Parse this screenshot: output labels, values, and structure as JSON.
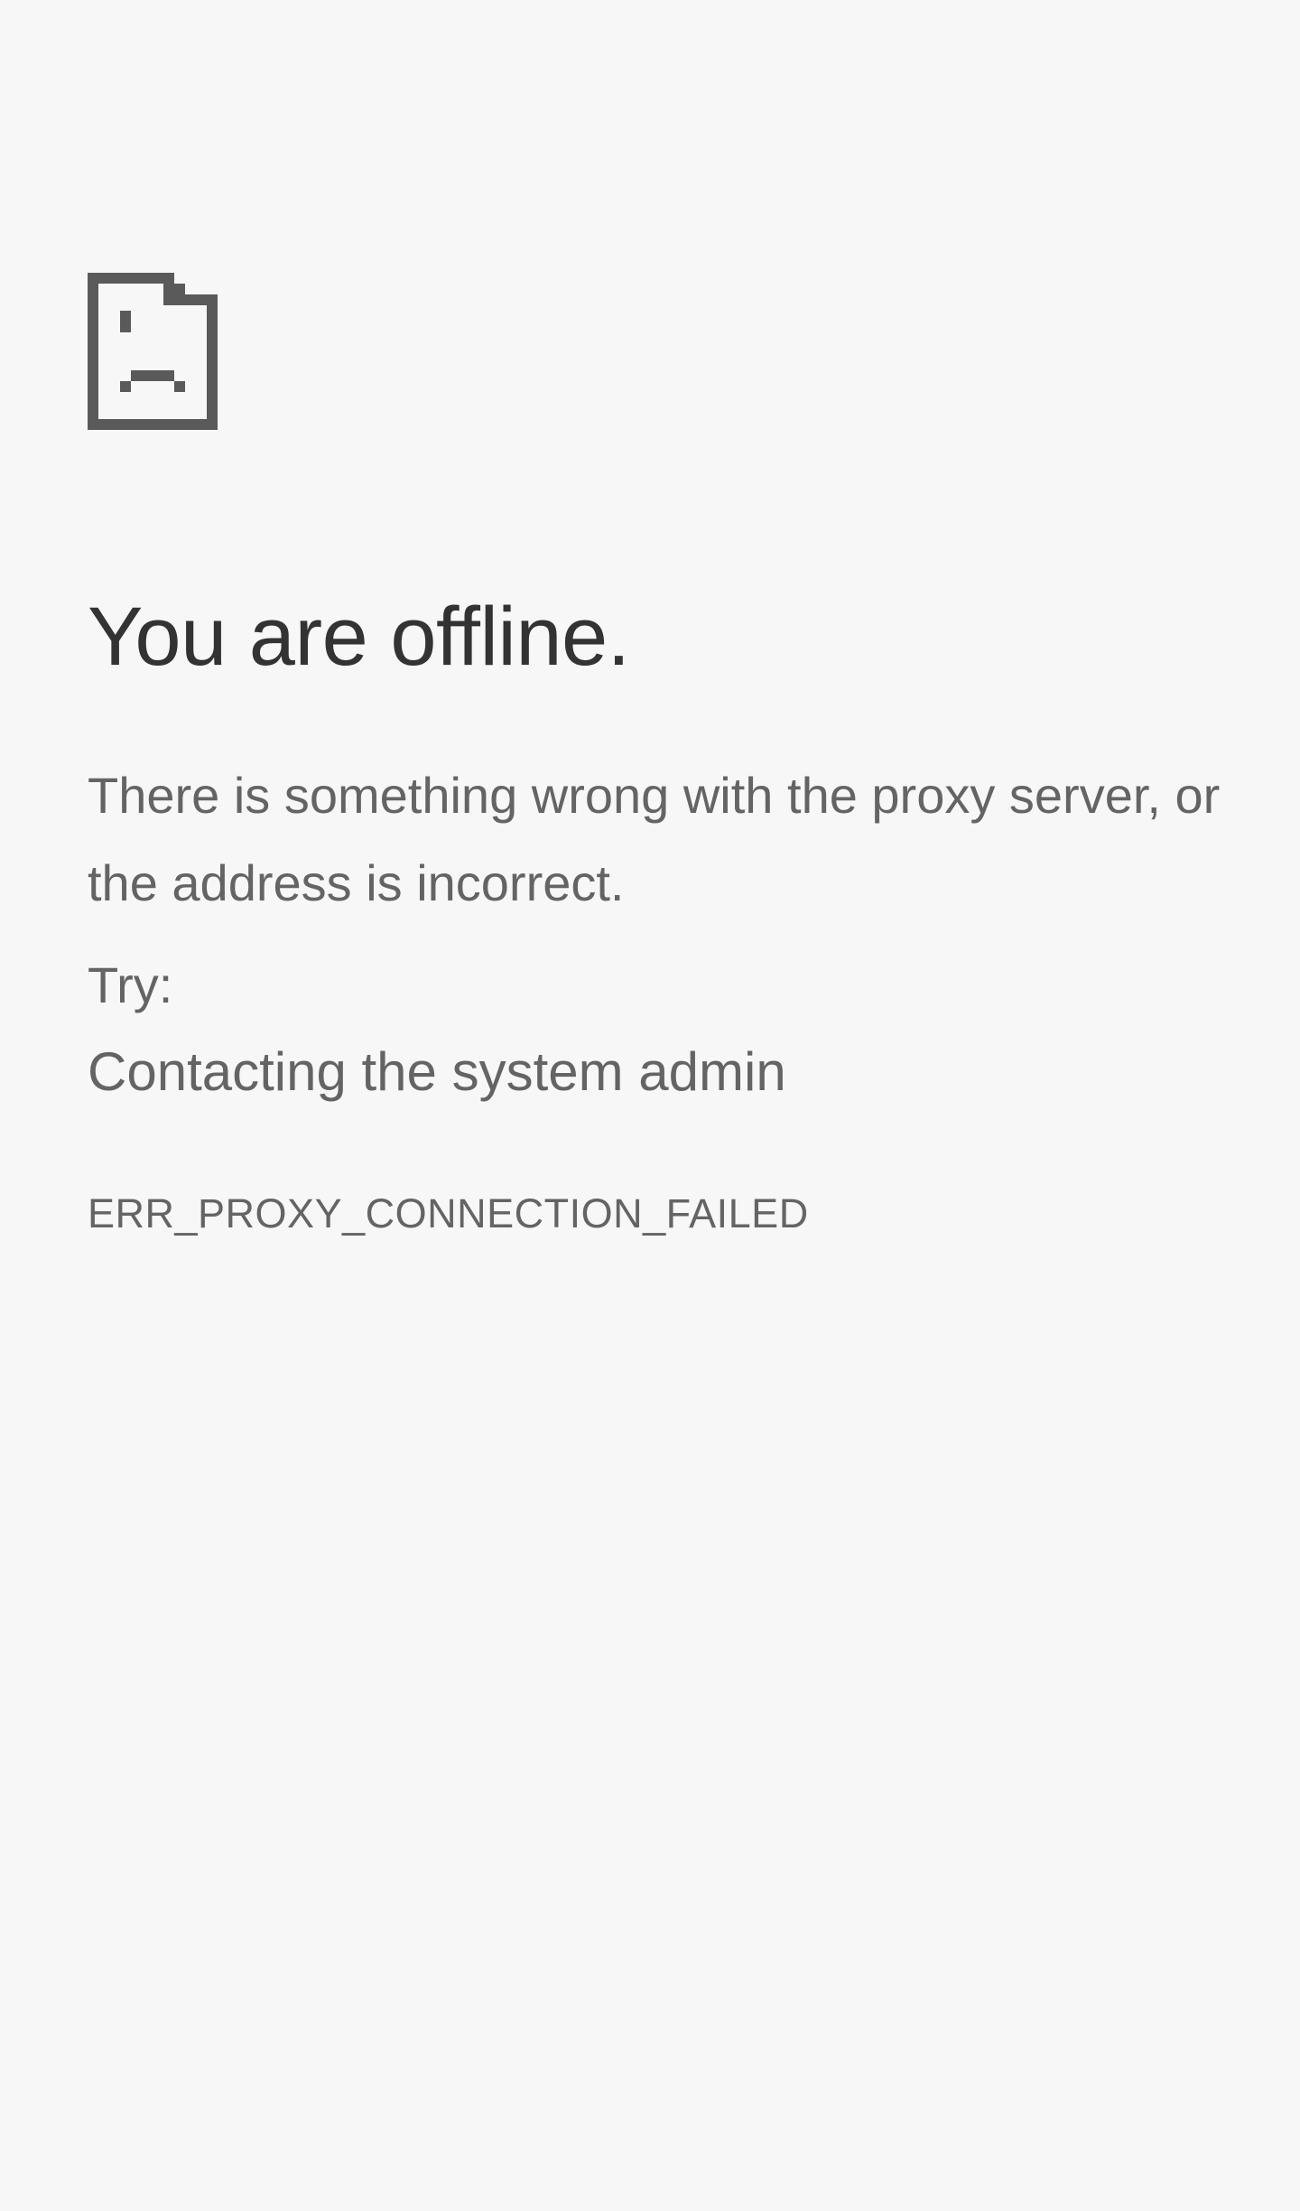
{
  "error_page": {
    "icon": "sad-document-icon",
    "title": "You are offline.",
    "message": "There is something wrong with the proxy server, or the address is incorrect.",
    "try_label": "Try:",
    "suggestions": [
      "Contacting the system admin"
    ],
    "error_code": "ERR_PROXY_CONNECTION_FAILED"
  },
  "colors": {
    "background": "#f7f7f7",
    "title": "#333333",
    "body_text": "#646464",
    "icon": "#5a5a5a"
  }
}
